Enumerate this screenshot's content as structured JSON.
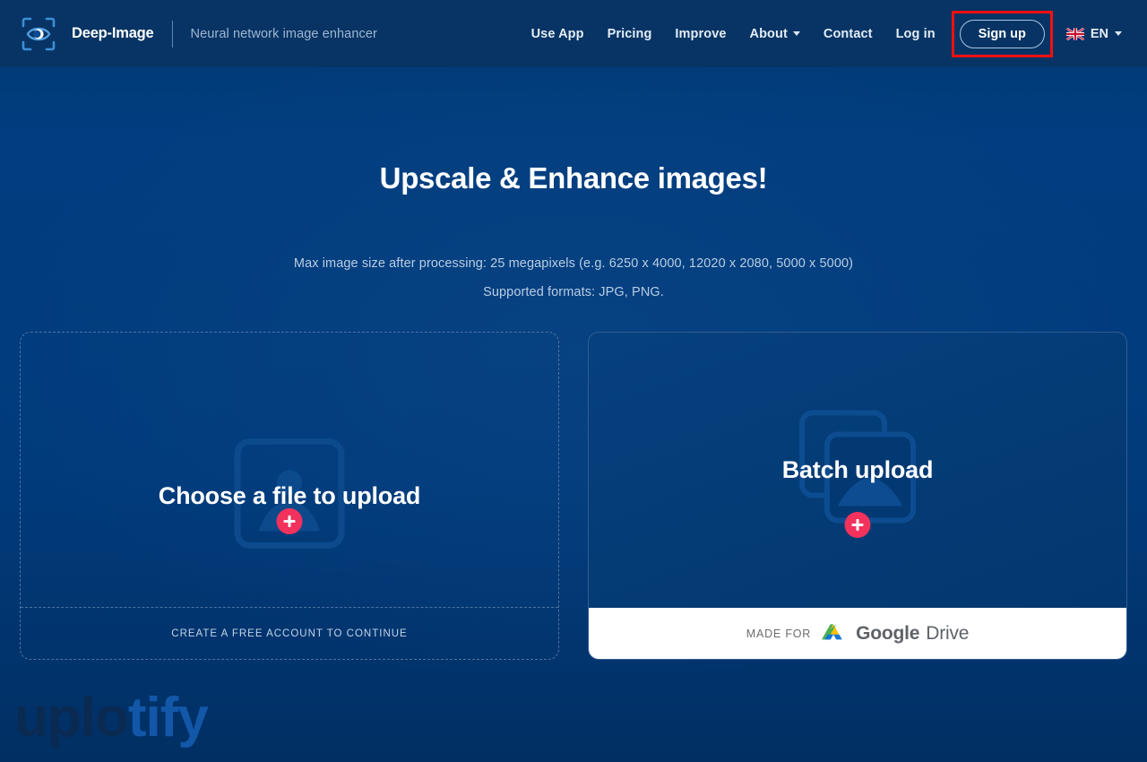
{
  "header": {
    "logo_icon": "eye-scan-icon",
    "brand_name": "Deep-Image",
    "tagline": "Neural network image enhancer",
    "nav_items": [
      {
        "label": "Use App",
        "has_caret": false
      },
      {
        "label": "Pricing",
        "has_caret": false
      },
      {
        "label": "Improve",
        "has_caret": false
      },
      {
        "label": "About",
        "has_caret": true
      },
      {
        "label": "Contact",
        "has_caret": false
      },
      {
        "label": "Log in",
        "has_caret": false
      }
    ],
    "signup_label": "Sign up",
    "language": {
      "code": "EN",
      "flag_icon": "uk-flag-icon",
      "caret_icon": "chevron-down-icon"
    },
    "highlight_color": "#f40f0f"
  },
  "hero": {
    "title": "Upscale & Enhance images!",
    "line1": "Max image size after processing: 25 megapixels (e.g. 6250 x 4000, 12020 x 2080, 5000 x 5000)",
    "line2": "Supported formats: JPG, PNG."
  },
  "upload_left": {
    "title": "Choose a file to upload",
    "icon": "image-placeholder-icon",
    "plus_icon": "plus-icon",
    "footer_link": "CREATE A FREE ACCOUNT TO CONTINUE"
  },
  "upload_right": {
    "title": "Batch upload",
    "icon": "stacked-images-icon",
    "plus_icon": "plus-icon",
    "made_for": "MADE FOR",
    "brand_google": "Google",
    "brand_drive": "Drive",
    "drive_icon": "google-drive-icon"
  },
  "watermark": {
    "part1": "uplo",
    "part2": "tify"
  },
  "colors": {
    "background": "#013b7c",
    "header": "#073464",
    "accent_pink": "#f2325d",
    "annotation_red": "#f40f0f",
    "text_muted": "#b9cde3"
  }
}
